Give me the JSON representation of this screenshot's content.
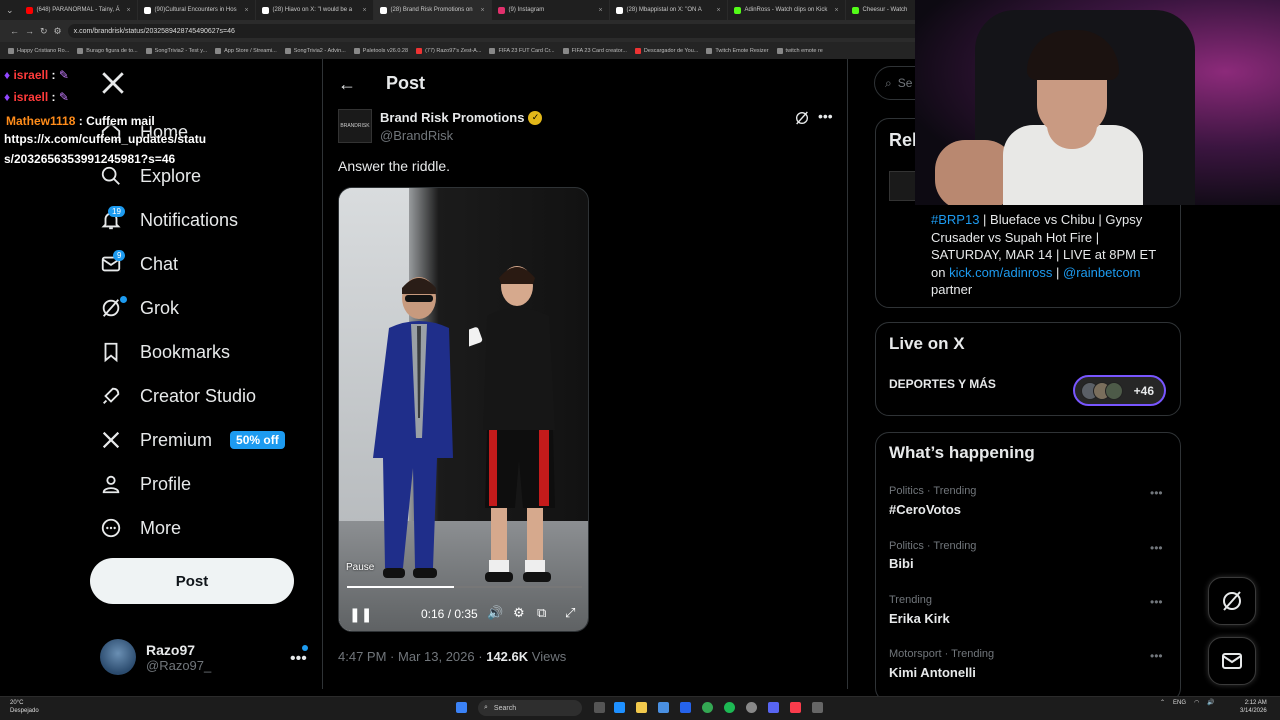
{
  "browser": {
    "tabs": [
      {
        "title": "(648) PARANORMAL - Tainy, Á",
        "color": "#ff0000"
      },
      {
        "title": "(90)Cultural Encounters in Hos",
        "color": "#ffffff"
      },
      {
        "title": "(28) Hiavo on X: \"I would be a",
        "color": "#ffffff"
      },
      {
        "title": "(28) Brand Risk Promotions on",
        "color": "#ffffff"
      },
      {
        "title": "(9) Instagram",
        "color": "#e1306c"
      },
      {
        "title": "(28) Mbappistal on X: \"ON A",
        "color": "#ffffff"
      },
      {
        "title": "AdinRoss - Watch clips on Kick",
        "color": "#53fc18"
      },
      {
        "title": "Cheesur - Watch",
        "color": "#53fc18"
      }
    ],
    "url": "x.com/brandrisk/status/2032589428745490627s=46",
    "bookmarks": [
      "Happy Cristiano Ro...",
      "Burago figura de to...",
      "SongTrivia2 - Test y...",
      "App Store / Streami...",
      "SongTrivia2 - Advin...",
      "Paletools v26.0.28",
      "(77) Razo97's Zest-A...",
      "FIFA 23 FUT Card Cr...",
      "FIFA 23 Card creator...",
      "Descargador de You...",
      "Twitch Emote Resizer",
      "twitch emote re"
    ]
  },
  "chat": [
    {
      "user": "israell",
      "sep": ":",
      "text": ""
    },
    {
      "user": "israell",
      "sep": ":",
      "text": ""
    },
    {
      "user": "Mathew1118",
      "sep": ":",
      "text": "Cuffem mail",
      "color": "#ff8c1a"
    },
    {
      "text": "https://x.com/cuffem_updates/statu"
    },
    {
      "text": "s/2032656353991245981?s=46"
    }
  ],
  "nav": {
    "home": "Home",
    "explore": "Explore",
    "notifications": "Notifications",
    "notifications_count": "19",
    "chat": "Chat",
    "chat_count": "9",
    "grok": "Grok",
    "bookmarks": "Bookmarks",
    "creator_studio": "Creator Studio",
    "premium": "Premium",
    "premium_badge": "50% off",
    "profile": "Profile",
    "more": "More",
    "post_button": "Post"
  },
  "account": {
    "name": "Razo97",
    "handle": "@Razo97_"
  },
  "post": {
    "header": "Post",
    "author_name": "Brand Risk Promotions",
    "author_handle": "@BrandRisk",
    "author_avatar_text": "BRANDRISK",
    "text": "Answer the riddle.",
    "video": {
      "pause_label": "Pause",
      "time": "0:16 / 0:35",
      "progress": 0.457
    },
    "time": "4:47 PM",
    "date": "Mar 13, 2026",
    "views_count": "142.6K",
    "views_label": "Views",
    "sep": "·"
  },
  "right": {
    "search_placeholder": "Se",
    "related_title": "Rel",
    "bio_hashtag": "#BRP13",
    "bio_text1": " | Blueface vs Chibu | Gypsy Crusader vs Supah Hot Fire | SATURDAY, MAR 14 | LIVE at 8PM ET on ",
    "bio_link1": "kick.com/adinross",
    "bio_text2": " | ",
    "bio_link2": "@rainbetcom",
    "bio_text3": " partner",
    "live_title": "Live on X",
    "live_sub": "DEPORTES Y MÁS",
    "live_count": "+46",
    "trends_title": "What’s happening",
    "trends": [
      {
        "category": "Politics · Trending",
        "name": "#CeroVotos"
      },
      {
        "category": "Politics · Trending",
        "name": "Bibi"
      },
      {
        "category": "Trending",
        "name": "Erika Kirk"
      },
      {
        "category": "Motorsport · Trending",
        "name": "Kimi Antonelli"
      }
    ]
  },
  "taskbar": {
    "weather_temp": "20°C",
    "weather_desc": "Despejado",
    "search": "Search",
    "lang": "ENG",
    "time": "2:12 AM",
    "date": "3/14/2026"
  }
}
